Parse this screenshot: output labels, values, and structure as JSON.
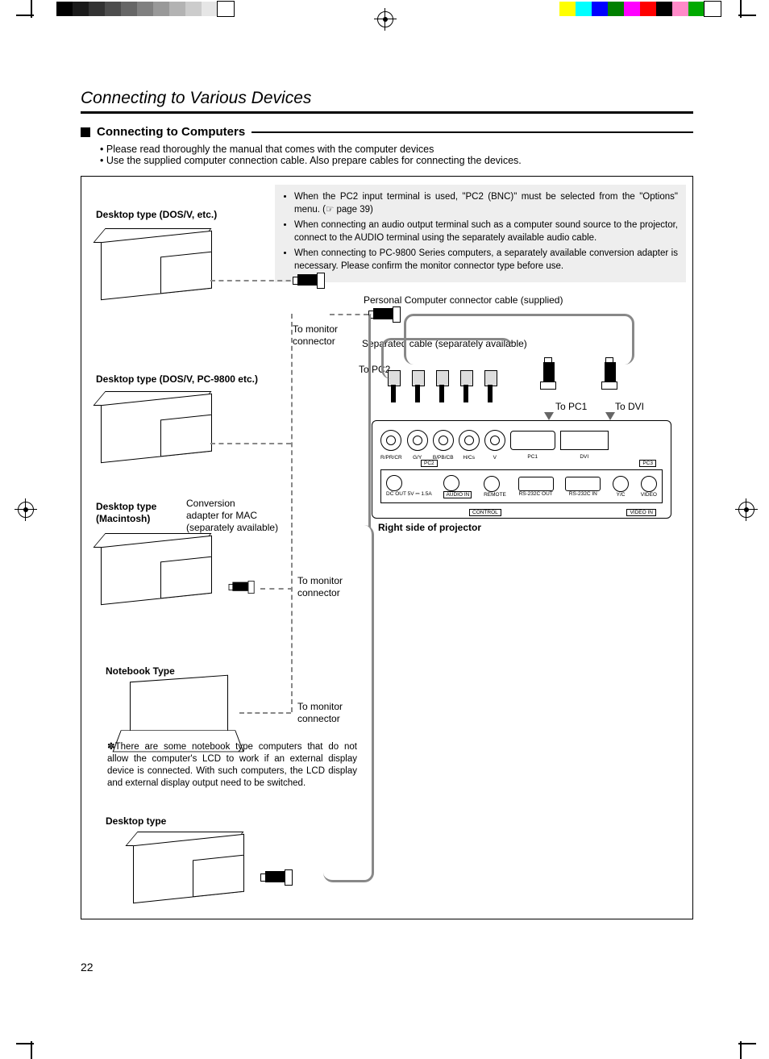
{
  "header": {
    "title": "Connecting to Various Devices"
  },
  "section": {
    "heading": "Connecting to Computers",
    "bullets": [
      "Please read thoroughly the manual that comes with the computer devices",
      "Use the supplied computer connection cable. Also prepare cables for connecting the devices."
    ]
  },
  "notebox": {
    "items": [
      "When the PC2 input terminal is used, \"PC2 (BNC)\" must be selected from the \"Options\" menu. (☞ page 39)",
      "When connecting an audio output terminal such as a computer sound source to the projector, connect to the AUDIO terminal using the separately available audio cable.",
      "When connecting to PC-9800 Series computers, a separately available conversion adapter is necessary. Please confirm the monitor connector type before use."
    ]
  },
  "labels": {
    "desktop1": "Desktop type (DOS/V, etc.)",
    "desktop2": "Desktop type (DOS/V, PC-9800 etc.)",
    "desktop3a": "Desktop type",
    "desktop3b": "(Macintosh)",
    "conv1": "Conversion",
    "conv2": "adapter for MAC",
    "conv3": "(separately available)",
    "notebook": "Notebook Type",
    "desktop5": "Desktop type",
    "to_monitor1": "To monitor",
    "to_monitor2": "connector",
    "pcc_cable": "Personal Computer connector cable (supplied)",
    "sep_cable": "Separated cable (separately available)",
    "to_pc2": "To PC2",
    "to_pc1": "To PC1",
    "to_dvi": "To DVI",
    "right_side": "Right side of projector"
  },
  "panel_labels": {
    "r": "R/PR/CR",
    "g": "G/Y",
    "b": "B/PB/CB",
    "h": "H/Cs",
    "v": "V",
    "pc2": "PC2",
    "pc1": "PC1",
    "dvi": "DVI",
    "pc3": "PC3",
    "dcout": "DC OUT 5V ⎓ 1.5A",
    "audio": "AUDIO IN",
    "remote": "REMOTE",
    "rsout": "RS-232C OUT",
    "rsin": "RS-232C IN",
    "control": "CONTROL",
    "yc": "Y/C",
    "video": "VIDEO",
    "videoin": "VIDEO IN"
  },
  "footnote": "✽There are some notebook type computers that do not allow the computer's LCD to work if an external display device is connected. With such computers, the LCD display and external display output need to be switched.",
  "page_number": "22",
  "colorbar_left": [
    "#000",
    "#1a1a1a",
    "#333",
    "#4d4d4d",
    "#666",
    "#808080",
    "#999",
    "#b3b3b3",
    "#ccc",
    "#e6e6e6",
    "#fff"
  ],
  "colorbar_right": [
    "#ff0",
    "#0ff",
    "#00f",
    "#008000",
    "#f0f",
    "#f00",
    "#000",
    "#ff8ac8",
    "#0a0",
    "#fff"
  ]
}
